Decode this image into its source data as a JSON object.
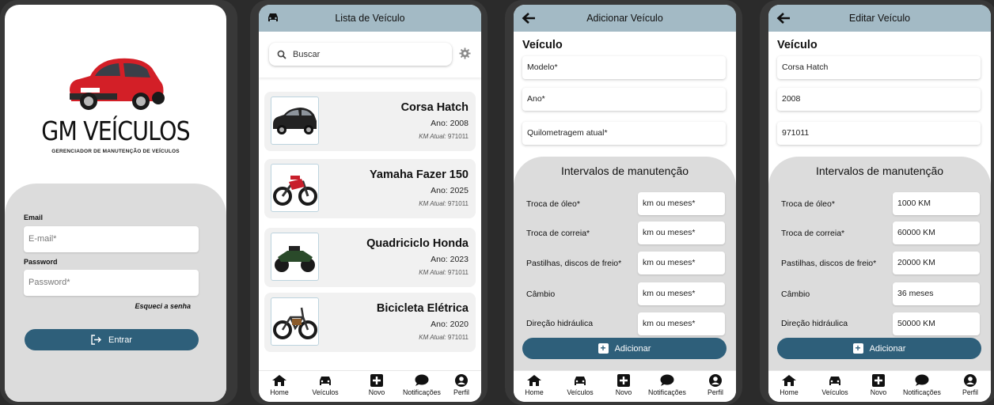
{
  "login": {
    "brand": "GM VEÍCULOS",
    "subtitle": "GERENCIADOR DE MANUTENÇÃO DE VEÍCULOS",
    "email_label": "Email",
    "email_placeholder": "E-mail*",
    "password_label": "Password",
    "password_placeholder": "Password*",
    "forgot": "Esqueci a senha",
    "submit": "Entrar"
  },
  "list": {
    "title": "Lista de Veículo",
    "search_placeholder": "Buscar",
    "vehicles": [
      {
        "name": "Corsa Hatch",
        "year": "Ano: 2008",
        "km_label": "KM Atual:",
        "km": "971011"
      },
      {
        "name": "Yamaha Fazer 150",
        "year": "Ano: 2025",
        "km_label": "KM Atual:",
        "km": "971011"
      },
      {
        "name": "Quadriciclo Honda",
        "year": "Ano: 2023",
        "km_label": "KM Atual:",
        "km": "971011"
      },
      {
        "name": "Bicicleta Elétrica",
        "year": "Ano: 2020",
        "km_label": "KM Atual:",
        "km": "971011"
      }
    ]
  },
  "nav": {
    "home": "Home",
    "vehicles": "Veículos",
    "new": "Novo",
    "notifications": "Notificações",
    "profile": "Perfil"
  },
  "add": {
    "title": "Adicionar Veículo",
    "section": "Veículo",
    "model": "Modelo*",
    "year": "Ano*",
    "mileage": "Quilometragem atual*",
    "maint_title": "Intervalos de manutenção",
    "items": [
      {
        "label": "Troca de óleo*",
        "value": "km ou meses*"
      },
      {
        "label": "Troca de correia*",
        "value": "km ou meses*"
      },
      {
        "label": "Pastilhas, discos de freio*",
        "value": "km ou meses*"
      },
      {
        "label": "Câmbio",
        "value": "km ou meses*"
      },
      {
        "label": "Direção hidráulica",
        "value": "km ou meses*"
      }
    ],
    "submit": "Adicionar"
  },
  "edit": {
    "title": "Editar Veículo",
    "section": "Veículo",
    "model": "Corsa Hatch",
    "year": "2008",
    "mileage": "971011",
    "maint_title": "Intervalos de manutenção",
    "items": [
      {
        "label": "Troca de óleo*",
        "value": "1000 KM"
      },
      {
        "label": "Troca de correia*",
        "value": "60000 KM"
      },
      {
        "label": "Pastilhas, discos de freio*",
        "value": "20000 KM"
      },
      {
        "label": "Câmbio",
        "value": "36 meses"
      },
      {
        "label": "Direção hidráulica",
        "value": "50000 KM"
      }
    ],
    "submit": "Adicionar"
  },
  "colors": {
    "header": "#a3bac5",
    "primary": "#2e5f7a",
    "panel": "#dcdcdc",
    "card": "#f1f1f1",
    "car_red": "#d31f27"
  }
}
